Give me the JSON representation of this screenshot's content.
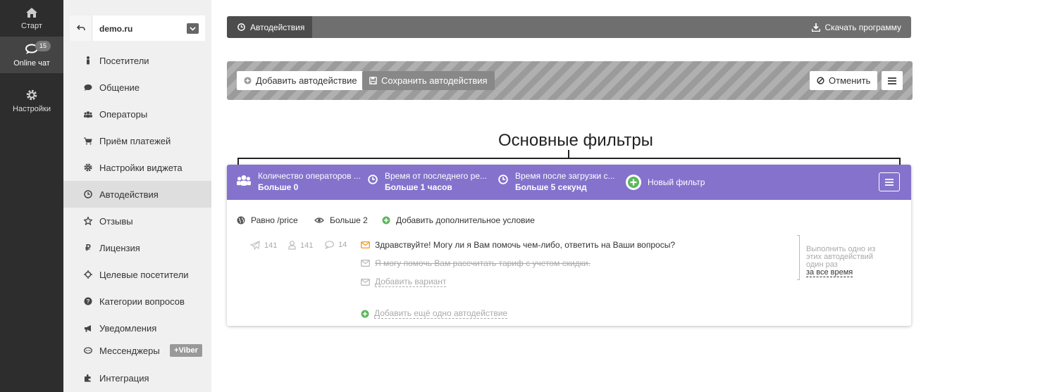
{
  "rail": {
    "items": [
      {
        "label": "Старт",
        "icon": "home-icon"
      },
      {
        "label": "Online чат",
        "icon": "chat-icon",
        "badge": "15"
      },
      {
        "label": "Настройки",
        "icon": "gear-icon"
      }
    ]
  },
  "site": {
    "name": "demo.ru"
  },
  "sidebar": {
    "items": [
      {
        "label": "Посетители"
      },
      {
        "label": "Общение"
      },
      {
        "label": "Операторы"
      },
      {
        "label": "Приём платежей"
      },
      {
        "label": "Настройки виджета"
      },
      {
        "label": "Автодействия"
      },
      {
        "label": "Отзывы"
      },
      {
        "label": "Лицензия"
      },
      {
        "label": "Целевые посетители"
      },
      {
        "label": "Категории вопросов"
      },
      {
        "label": "Уведомления"
      },
      {
        "label": "Мессенджеры",
        "badge": "+Viber"
      },
      {
        "label": "Интеграция"
      }
    ]
  },
  "topbar": {
    "tab": "Автодействия",
    "download": "Скачать программу"
  },
  "actions": {
    "add": "Добавить автодействие",
    "save": "Сохранить автодействия",
    "cancel": "Отменить"
  },
  "annotation": {
    "heading": "Основные фильтры"
  },
  "filters": [
    {
      "title": "Количество операторов ...",
      "value": "Больше 0"
    },
    {
      "title": "Время от последнего ре...",
      "value": "Больше 1 часов"
    },
    {
      "title": "Время после загрузки с...",
      "value": "Больше 5 секунд"
    }
  ],
  "new_filter": "Новый фильтр",
  "conditions": [
    {
      "label": "Равно /price"
    },
    {
      "label": "Больше 2"
    },
    {
      "label": "Добавить дополнительное условие"
    }
  ],
  "stats": {
    "sent": "141",
    "users": "141",
    "replies": "14"
  },
  "messages": {
    "first": "Здравствуйте! Могу ли я Вам помочь чем-либо, ответить на Ваши вопросы?",
    "second": "Я могу помочь Вам рассчитать тариф с учетом скидки.",
    "add_variant": "Добавить вариант",
    "add_another": "Добавить ещё одно автодействие"
  },
  "note": {
    "text": "Выполнить одно из этих автодействий один раз",
    "link": "за все время"
  },
  "colors": {
    "accent": "#8472cd",
    "rail": "#2d2d2d",
    "sidebar": "#f0f0f0",
    "mail": "#f0a030",
    "add": "#5cb85c"
  }
}
